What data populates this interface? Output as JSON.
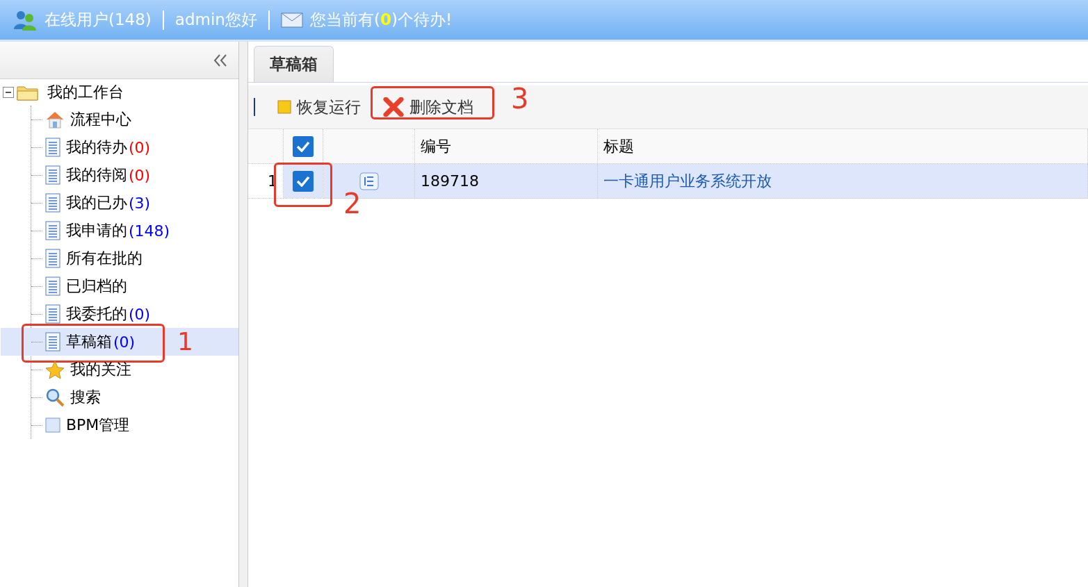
{
  "header": {
    "online_users": "在线用户(148)",
    "greeting": "admin您好",
    "todo_prefix": "您当前有(",
    "todo_count": "0",
    "todo_suffix": ")个待办!"
  },
  "sidebar": {
    "tree": [
      {
        "label": "我的工作台",
        "kind": "folder",
        "expanded": true,
        "selected": false,
        "children": [
          {
            "label": "流程中心",
            "kind": "home",
            "selected": false
          },
          {
            "label": "我的待办",
            "count": "(0)",
            "color": "#ff0000",
            "kind": "doc",
            "selected": false
          },
          {
            "label": "我的待阅",
            "count": "(0)",
            "color": "#ff0000",
            "kind": "doc",
            "selected": false
          },
          {
            "label": "我的已办",
            "count": "(3)",
            "color": "#0000ff",
            "kind": "doc",
            "selected": false
          },
          {
            "label": "我申请的",
            "count": "(148)",
            "color": "#0000ff",
            "kind": "doc",
            "selected": false
          },
          {
            "label": "所有在批的",
            "kind": "doc",
            "selected": false
          },
          {
            "label": "已归档的",
            "kind": "doc",
            "selected": false
          },
          {
            "label": "我委托的",
            "count": "(0)",
            "color": "#0000ff",
            "kind": "doc",
            "selected": false
          },
          {
            "label": "草稿箱",
            "count": "(0)",
            "color": "#0000ff",
            "kind": "doc",
            "selected": true,
            "annotation": "1"
          },
          {
            "label": "我的关注",
            "kind": "star",
            "selected": false
          },
          {
            "label": "搜索",
            "kind": "search",
            "selected": false
          },
          {
            "label": "BPM管理",
            "kind": "square",
            "selected": false
          }
        ]
      }
    ]
  },
  "tabs": [
    {
      "label": "草稿箱",
      "selected": true
    }
  ],
  "toolbar": [
    {
      "label": "恢复运行",
      "kind": "resume"
    },
    {
      "label": "删除文档",
      "kind": "delete",
      "annotation": "3"
    }
  ],
  "table": {
    "header_checked": true,
    "columns": [
      "编号",
      "标题"
    ],
    "rows": [
      {
        "index": "1",
        "checked": true,
        "selected": true,
        "number": "189718",
        "title": "一卡通用户业务系统开放",
        "annotation": "2"
      }
    ]
  }
}
